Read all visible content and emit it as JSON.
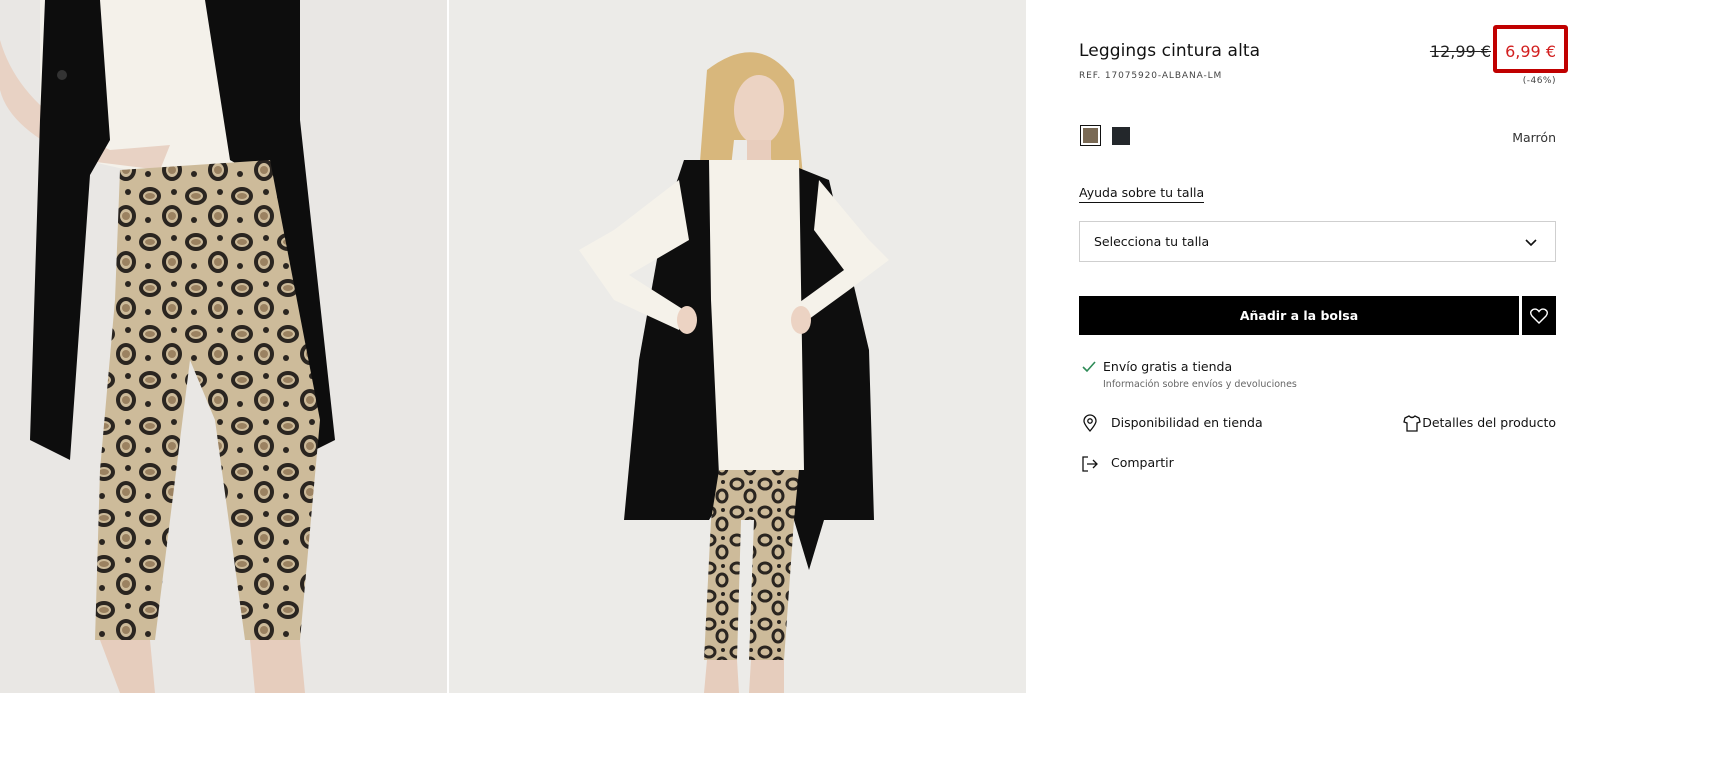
{
  "product": {
    "title": "Leggings cintura alta",
    "ref": "REF. 17075920-ALBANA-LM",
    "price_old": "12,99 €",
    "price_new": "6,99 €",
    "discount": "(-46%)"
  },
  "colors": {
    "selected_name": "Marrón",
    "swatches": [
      "#7a6a55",
      "#23272b"
    ]
  },
  "size": {
    "help_link": "Ayuda sobre tu talla",
    "select_label": "Selecciona tu talla"
  },
  "actions": {
    "add_to_bag": "Añadir a la bolsa"
  },
  "shipping": {
    "title": "Envío gratis a tienda",
    "subtitle": "Información sobre envíos y devoluciones"
  },
  "links": {
    "store_availability": "Disponibilidad en tienda",
    "product_details": "Detalles del producto",
    "share": "Compartir"
  },
  "theme": {
    "accent_red": "#c00000",
    "sale_red": "#d21f1f",
    "check_green": "#2e8b57"
  }
}
